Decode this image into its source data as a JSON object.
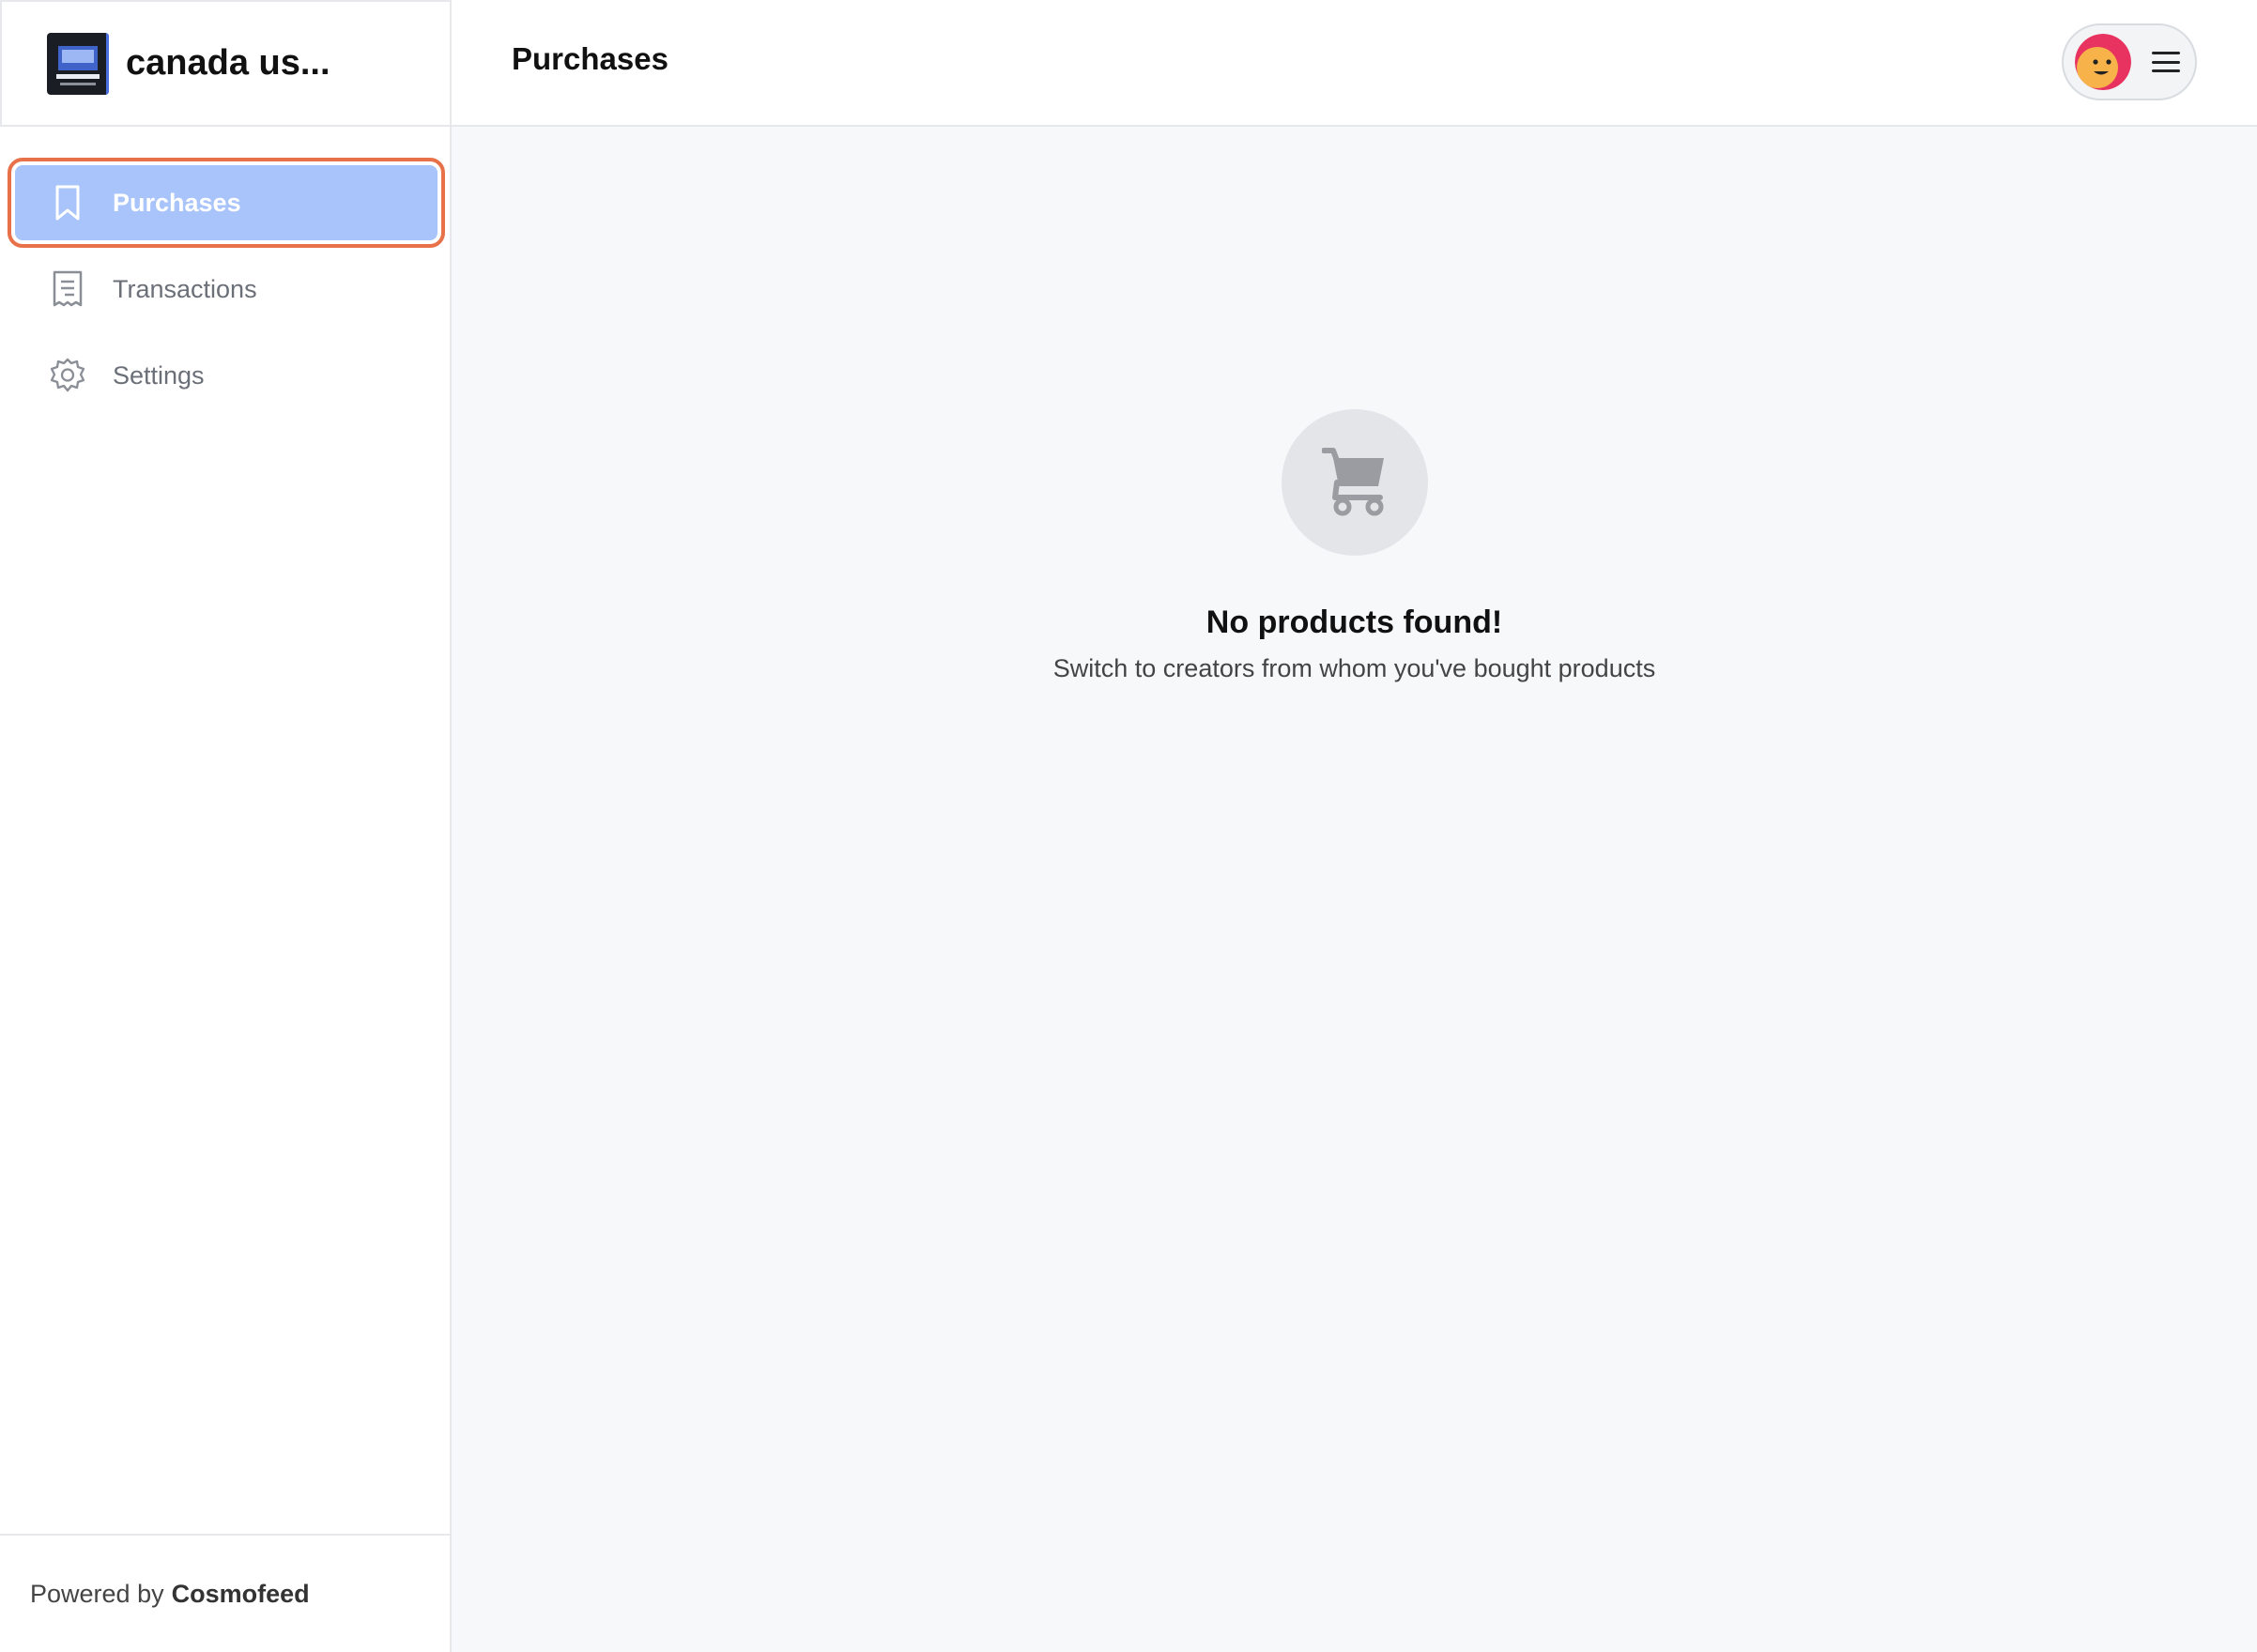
{
  "brand": {
    "name": "canada us..."
  },
  "sidebar": {
    "items": [
      {
        "label": "Purchases",
        "icon": "bookmark-icon",
        "active": true
      },
      {
        "label": "Transactions",
        "icon": "receipt-icon",
        "active": false
      },
      {
        "label": "Settings",
        "icon": "gear-icon",
        "active": false
      }
    ],
    "footer": {
      "prefix": "Powered by",
      "brand": "Cosmofeed"
    }
  },
  "header": {
    "title": "Purchases"
  },
  "empty_state": {
    "icon": "shopping-cart-icon",
    "title": "No products found!",
    "subtitle": "Switch to creators from whom you've bought products"
  },
  "colors": {
    "active_bg": "#a8c4fa",
    "active_outline": "#e8714a",
    "page_bg": "#f7f8fa"
  }
}
